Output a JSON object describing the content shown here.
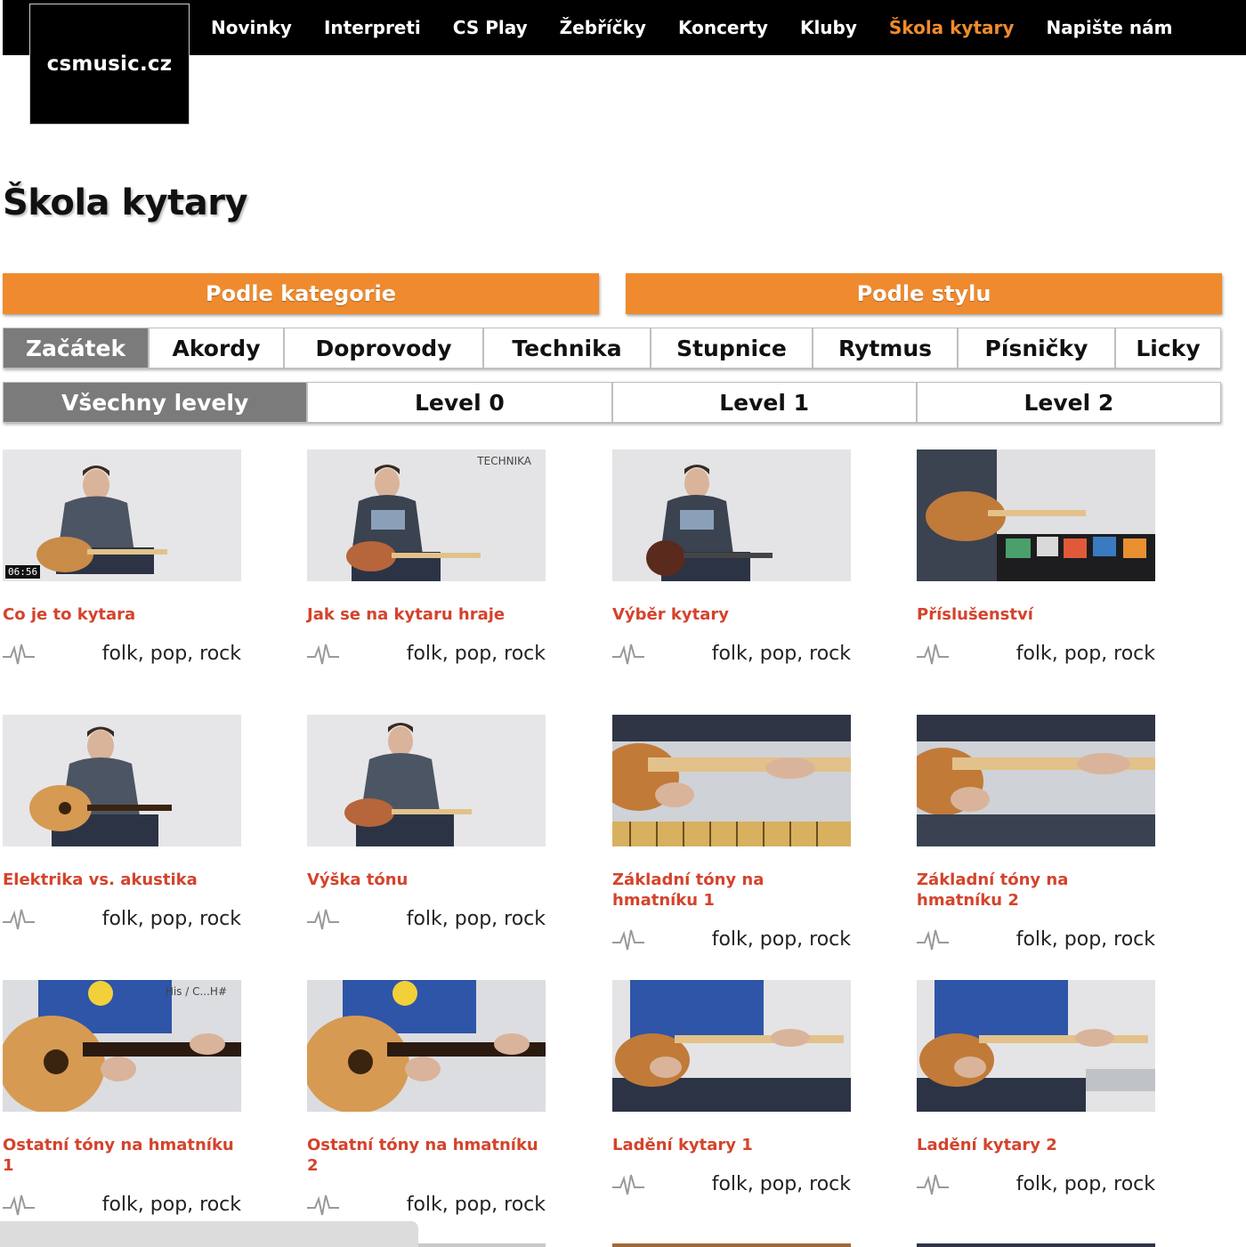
{
  "site": {
    "logo": "csmusic.cz"
  },
  "nav": [
    {
      "label": "Novinky",
      "active": false
    },
    {
      "label": "Interpreti",
      "active": false
    },
    {
      "label": "CS Play",
      "active": false
    },
    {
      "label": "Žebříčky",
      "active": false
    },
    {
      "label": "Koncerty",
      "active": false
    },
    {
      "label": "Kluby",
      "active": false
    },
    {
      "label": "Škola kytary",
      "active": true
    },
    {
      "label": "Napište nám",
      "active": false
    }
  ],
  "page": {
    "title": "Škola kytary"
  },
  "filters": {
    "by_category": "Podle kategorie",
    "by_style": "Podle stylu"
  },
  "categories": [
    {
      "label": "Začátek",
      "active": true
    },
    {
      "label": "Akordy",
      "active": false
    },
    {
      "label": "Doprovody",
      "active": false
    },
    {
      "label": "Technika",
      "active": false
    },
    {
      "label": "Stupnice",
      "active": false
    },
    {
      "label": "Rytmus",
      "active": false
    },
    {
      "label": "Písničky",
      "active": false
    },
    {
      "label": "Licky",
      "active": false
    }
  ],
  "levels": [
    {
      "label": "Všechny levely",
      "active": true
    },
    {
      "label": "Level 0",
      "active": false
    },
    {
      "label": "Level 1",
      "active": false
    },
    {
      "label": "Level 2",
      "active": false
    }
  ],
  "videos": [
    {
      "title": "Co je to kytara",
      "styles": "folk, pop, rock",
      "duration": "06:56",
      "badge": ""
    },
    {
      "title": "Jak se na kytaru hraje",
      "styles": "folk, pop, rock",
      "duration": "",
      "badge": "TECHNIKA"
    },
    {
      "title": "Výběr kytary",
      "styles": "folk, pop, rock",
      "duration": "",
      "badge": ""
    },
    {
      "title": "Příslušenství",
      "styles": "folk, pop, rock",
      "duration": "",
      "badge": ""
    },
    {
      "title": "Elektrika vs. akustika",
      "styles": "folk, pop, rock",
      "duration": "",
      "badge": ""
    },
    {
      "title": "Výška tónu",
      "styles": "folk, pop, rock",
      "duration": "",
      "badge": ""
    },
    {
      "title": "Základní tóny na hmatníku 1",
      "styles": "folk, pop, rock",
      "duration": "",
      "badge": ""
    },
    {
      "title": "Základní tóny na hmatníku 2",
      "styles": "folk, pop, rock",
      "duration": "",
      "badge": ""
    },
    {
      "title": "Ostatní tóny na hmatníku 1",
      "styles": "folk, pop, rock",
      "duration": "",
      "badge": "His / C...H#"
    },
    {
      "title": "Ostatní tóny na hmatníku 2",
      "styles": "folk, pop, rock",
      "duration": "",
      "badge": ""
    },
    {
      "title": "Ladění kytary 1",
      "styles": "folk, pop, rock",
      "duration": "",
      "badge": ""
    },
    {
      "title": "Ladění kytary 2",
      "styles": "folk, pop, rock",
      "duration": "",
      "badge": ""
    }
  ],
  "colors": {
    "accent": "#ef8b2e",
    "title_red": "#d4432c",
    "active_tab": "#7b7b7b",
    "nav_bg": "#000000"
  }
}
